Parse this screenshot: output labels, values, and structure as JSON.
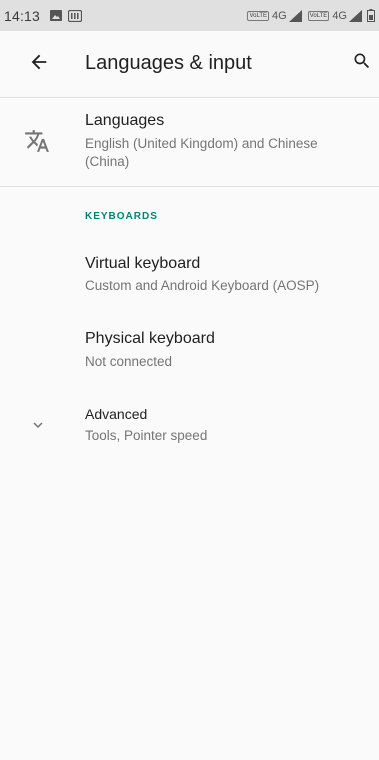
{
  "status_bar": {
    "time": "14:13",
    "sim1": "VoLTE",
    "net1": "4G",
    "sim2": "VoLTE",
    "net2": "4G"
  },
  "toolbar": {
    "title": "Languages & input"
  },
  "languages": {
    "title": "Languages",
    "summary": "English (United Kingdom) and Chinese (China)"
  },
  "keyboards": {
    "header": "KEYBOARDS",
    "virtual": {
      "title": "Virtual keyboard",
      "summary": "Custom and Android Keyboard (AOSP)"
    },
    "physical": {
      "title": "Physical keyboard",
      "summary": "Not connected"
    }
  },
  "advanced": {
    "title": "Advanced",
    "summary": "Tools, Pointer speed"
  },
  "colors": {
    "accent": "#008577",
    "background": "#fafafa",
    "status_bar": "#e0e0e0"
  }
}
